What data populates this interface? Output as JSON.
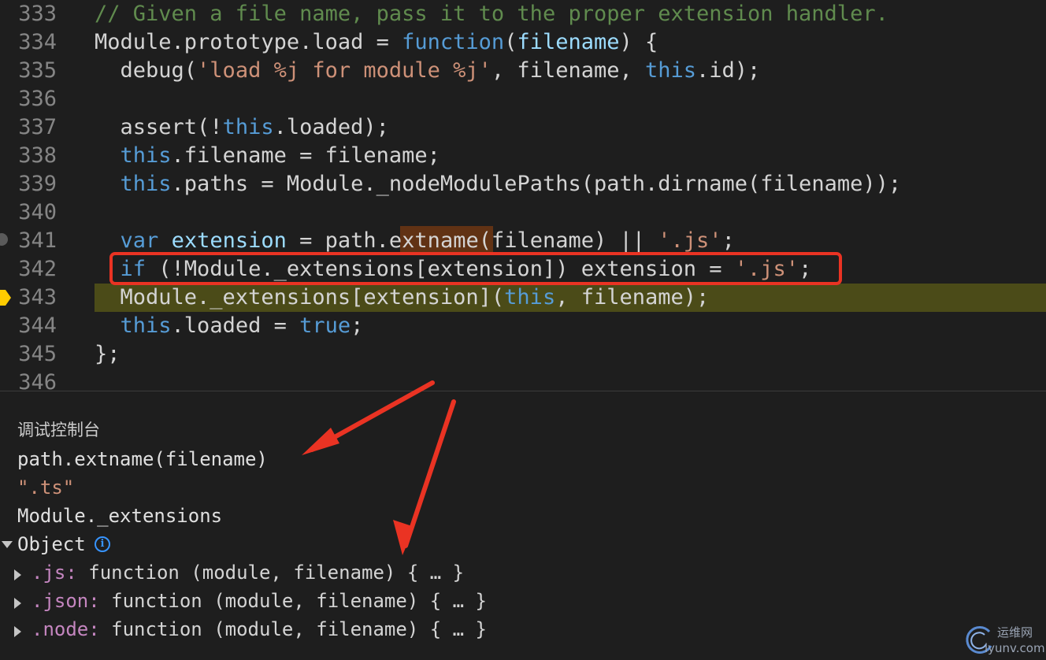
{
  "editor": {
    "lines": [
      {
        "num": "333",
        "tokens": [
          {
            "t": "// Given a file name, pass it to the proper extension handler.",
            "c": "cm"
          }
        ]
      },
      {
        "num": "334",
        "tokens": [
          {
            "t": "Module.prototype.load = ",
            "c": "fn"
          },
          {
            "t": "function",
            "c": "kw"
          },
          {
            "t": "(",
            "c": "fn"
          },
          {
            "t": "filename",
            "c": "id"
          },
          {
            "t": ") {",
            "c": "fn"
          }
        ]
      },
      {
        "num": "335",
        "tokens": [
          {
            "t": "  debug(",
            "c": "fn"
          },
          {
            "t": "'load %j for module %j'",
            "c": "str"
          },
          {
            "t": ", filename, ",
            "c": "fn"
          },
          {
            "t": "this",
            "c": "kw"
          },
          {
            "t": ".id);",
            "c": "fn"
          }
        ]
      },
      {
        "num": "336",
        "tokens": []
      },
      {
        "num": "337",
        "tokens": [
          {
            "t": "  assert(!",
            "c": "fn"
          },
          {
            "t": "this",
            "c": "kw"
          },
          {
            "t": ".loaded);",
            "c": "fn"
          }
        ]
      },
      {
        "num": "338",
        "tokens": [
          {
            "t": "  ",
            "c": "fn"
          },
          {
            "t": "this",
            "c": "kw"
          },
          {
            "t": ".filename = filename;",
            "c": "fn"
          }
        ]
      },
      {
        "num": "339",
        "tokens": [
          {
            "t": "  ",
            "c": "fn"
          },
          {
            "t": "this",
            "c": "kw"
          },
          {
            "t": ".paths = Module._nodeModulePaths(path.dirname(filename));",
            "c": "fn"
          }
        ]
      },
      {
        "num": "340",
        "tokens": []
      },
      {
        "num": "341",
        "tokens": [
          {
            "t": "  ",
            "c": "fn"
          },
          {
            "t": "var",
            "c": "kw"
          },
          {
            "t": " ",
            "c": "fn"
          },
          {
            "t": "extension",
            "c": "id"
          },
          {
            "t": " = path.extname(filename) || ",
            "c": "fn"
          },
          {
            "t": "'.js'",
            "c": "str"
          },
          {
            "t": ";",
            "c": "fn"
          }
        ]
      },
      {
        "num": "342",
        "tokens": [
          {
            "t": "  ",
            "c": "fn"
          },
          {
            "t": "if",
            "c": "kw"
          },
          {
            "t": " (!Module._extensions[extension]) extension = ",
            "c": "fn"
          },
          {
            "t": "'.js'",
            "c": "str"
          },
          {
            "t": ";",
            "c": "fn"
          }
        ]
      },
      {
        "num": "343",
        "tokens": [
          {
            "t": "  Module._extensions[extension](",
            "c": "fn"
          },
          {
            "t": "this",
            "c": "kw"
          },
          {
            "t": ", filename);",
            "c": "fn"
          }
        ]
      },
      {
        "num": "344",
        "tokens": [
          {
            "t": "  ",
            "c": "fn"
          },
          {
            "t": "this",
            "c": "kw"
          },
          {
            "t": ".loaded = ",
            "c": "fn"
          },
          {
            "t": "true",
            "c": "kw"
          },
          {
            "t": ";",
            "c": "fn"
          }
        ]
      },
      {
        "num": "345",
        "tokens": [
          {
            "t": "};",
            "c": "fn"
          }
        ]
      },
      {
        "num": "346",
        "tokens": []
      }
    ]
  },
  "console": {
    "title": "调试控制台",
    "expr1": "path.extname(filename)",
    "result1": "\".ts\"",
    "expr2": "Module._extensions",
    "object_label": "Object",
    "info_glyph": "i",
    "entries": [
      {
        "key": ".js:",
        "value": " function (module, filename) { … }"
      },
      {
        "key": ".json:",
        "value": " function (module, filename) { … }"
      },
      {
        "key": ".node:",
        "value": " function (module, filename) { … }"
      }
    ]
  },
  "watermark": {
    "line1": "运维网",
    "line2": "iyunv.com"
  },
  "colors": {
    "background": "#1e1e1e",
    "annotation_red": "#ea3323",
    "current_line": "#4b4b18",
    "keyword": "#569cd6",
    "string": "#ce9178",
    "comment": "#608b4e",
    "object_key": "#c586c0"
  }
}
